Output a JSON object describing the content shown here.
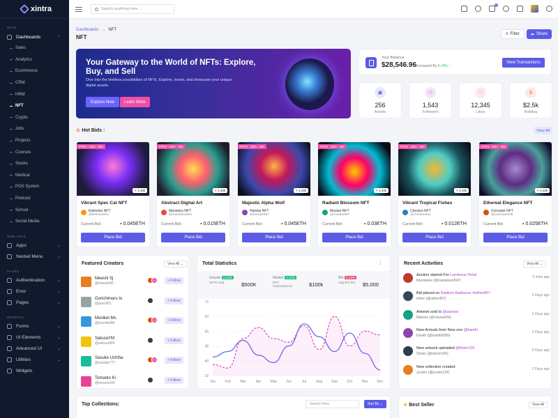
{
  "brand": {
    "name": "xintra"
  },
  "sidebar": {
    "section_main": "MAIN",
    "dashboards": "Dashboards",
    "dashboard_items": [
      "Sales",
      "Analytics",
      "Ecommerce",
      "CRM",
      "HRM",
      "NFT",
      "Crypto",
      "Jobs",
      "Projects",
      "Courses",
      "Stocks",
      "Medical",
      "POS System",
      "Podcast",
      "School",
      "Social Media"
    ],
    "active_item": "NFT",
    "section_web_apps": "WEB APPS",
    "apps": "Apps",
    "nested_menu": "Nested Menu",
    "section_pages": "PAGES",
    "authentication": "Authentication",
    "error": "Error",
    "pages": "Pages",
    "section_general": "GENERAL",
    "forms": "Forms",
    "ui_elements": "UI Elements",
    "advanced_ui": "Advanced UI",
    "utilities": "Utilities",
    "widgets": "Widgets"
  },
  "header": {
    "search_placeholder": "Search anything here ...",
    "cart_badge": "5"
  },
  "page": {
    "breadcrumb_root": "Dashboards",
    "breadcrumb_sep": "→",
    "breadcrumb_current": "NFT",
    "title": "NFT",
    "filter_label": "Filter",
    "share_label": "Share"
  },
  "hero": {
    "title": "Your Gateway to the World of NFTs: Explore, Buy, and Sell",
    "text": "Dive into the limitless possibilities of NFTs. Explore, invest, and showcase your unique digital assets.",
    "explore_label": "Explore Now",
    "learn_label": "Learn More"
  },
  "balance": {
    "label": "Your Balance",
    "value": "$28,546.96",
    "increase_label": "Increased By",
    "increase_value": "0.14%",
    "button": "View Transactions"
  },
  "stats": [
    {
      "value": "256",
      "label": "Assets",
      "color": "#5b5ce6"
    },
    {
      "value": "1,543",
      "label": "Followers",
      "color": "#ae3ec9"
    },
    {
      "value": "12,345",
      "label": "Likes",
      "color": "#ef4f8a"
    },
    {
      "value": "$2.5k",
      "label": "Bidding",
      "color": "#f06548"
    }
  ],
  "hot_bids": {
    "title": "Hot Bids :",
    "view_all": "View All",
    "cards": [
      {
        "timer": "07hrs : 33m : 45s",
        "likes": "1.43k",
        "name": "Vibrant Spec Cat NFT",
        "creator": "Kelinnies NFT",
        "handle": "@kelinnies04",
        "bid_label": "Current Bid :",
        "bid": "0.045ETH",
        "button": "Place Bid"
      },
      {
        "timer": "07hrs : 33m : 45s",
        "likes": "1.43k",
        "name": "Abstract Digital Art",
        "creator": "Manistics NFT",
        "handle": "@manistics454",
        "bid_label": "Current Bid :",
        "bid": "0.015ETH",
        "button": "Place Bid"
      },
      {
        "timer": "07hrs : 33m : 45s",
        "likes": "1.43k",
        "name": "Majestic Alpha Wolf",
        "creator": "Haridar NFT",
        "handle": "@haridar587",
        "bid_label": "Current Bid :",
        "bid": "0.045ETH",
        "button": "Place Bid"
      },
      {
        "timer": "07hrs : 33m : 45s",
        "likes": "1.43k",
        "name": "Radiant Blossom NFT",
        "creator": "Mostee NFT",
        "handle": "@mostee657",
        "bid_label": "Current Bid :",
        "bid": "0.03ETH",
        "button": "Place Bid"
      },
      {
        "timer": "07hrs : 33m : 45s",
        "likes": "1.43k",
        "name": "Vibrant Tropical Fishes",
        "creator": "Cheston NFT",
        "handle": "@cheston041",
        "bid_label": "Current Bid :",
        "bid": "0.012ETH",
        "button": "Place Bid"
      },
      {
        "timer": "07hrs : 33m : 45s",
        "likes": "1.43k",
        "name": "Ethereal Elegance NFT",
        "creator": "Cornoate NFT",
        "handle": "@cornoate245",
        "bid_label": "Current Bid :",
        "bid": "0.025ETH",
        "button": "Place Bid"
      }
    ]
  },
  "creators": {
    "title": "Featured Creators",
    "select": "View All",
    "follow_label": "+ Follow",
    "items": [
      {
        "name": "Meeshi Sj",
        "handle": "@meeshi05",
        "more": "+3"
      },
      {
        "name": "Gorichimaru Io",
        "handle": "@aaro901",
        "more": ""
      },
      {
        "name": "Moniket Ms",
        "handle": "@moniket98",
        "more": "+3"
      },
      {
        "name": "SakuraYM",
        "handle": "@sakura903",
        "more": ""
      },
      {
        "name": "Sasuke Uchiha",
        "handle": "@sasuke777",
        "more": "+3"
      },
      {
        "name": "Tomarko Ki",
        "handle": "@tomarko99",
        "more": ""
      }
    ]
  },
  "total_stats": {
    "title": "Total Statistics",
    "growth": {
      "label": "Growth",
      "badge": "0.14%",
      "sub": "NFTs sold",
      "value": "$500K"
    },
    "market": {
      "label": "Market",
      "badge": "0.14%",
      "sub": "NFT marketplaces",
      "value": "$100k"
    },
    "bid": {
      "label": "Bid",
      "badge": "0.14%",
      "sub": "Highest bid",
      "value": "$5,000"
    }
  },
  "chart_data": {
    "type": "line",
    "categories": [
      "Jan",
      "Feb",
      "Mar",
      "Apr",
      "May",
      "Jun",
      "Jul",
      "Aug",
      "Sep",
      "Oct",
      "Nov",
      "Dec"
    ],
    "yticks": [
      32,
      40,
      48,
      56,
      64,
      72
    ],
    "ylim": [
      32,
      72
    ],
    "series": [
      {
        "values": [
          42,
          45,
          51,
          43,
          39,
          48,
          60,
          53,
          45,
          55,
          44,
          35
        ],
        "color": "#5b5ce6"
      },
      {
        "values": [
          38,
          36,
          52,
          58,
          52,
          50,
          59,
          46,
          64,
          48,
          56,
          54
        ],
        "color": "#e040c8"
      }
    ]
  },
  "activities": {
    "title": "Recent Activities",
    "select": "View All",
    "items": [
      {
        "pre": "Auction started For ",
        "link": "Luminous Petal",
        "sub_pre": "Manistens ",
        "sub_link": "(@manistens547)",
        "time": "5 mins ago"
      },
      {
        "pre": "Bid placed on ",
        "link": "Radium Radiance #isther457",
        "sub_pre": "isther ",
        "sub_link": "(@isther457)",
        "time": "2 Days ago"
      },
      {
        "pre": "Artwork sold to ",
        "link": "@zanisis",
        "sub_pre": "Rakons ",
        "sub_link": "(@rokons656)",
        "time": "2 Days ago"
      },
      {
        "pre": "New Arrivals from New one ",
        "link": "@kanith",
        "sub_pre": "Kanith ",
        "sub_link": "(@kanith6589)",
        "time": "2 Days ago"
      },
      {
        "pre": "New artwork uploaded ",
        "link": "@fister124",
        "sub_pre": "Simon ",
        "sub_link": "(@simon145)",
        "time": "5 Days ago"
      },
      {
        "pre": "New collection created.",
        "link": "",
        "sub_pre": "Jovisin ",
        "sub_link": "(@jovisin124)",
        "time": "2 Days ago"
      }
    ]
  },
  "collections": {
    "title": "Top Collections:",
    "search_placeholder": "Search Here",
    "sort_label": "Sort By"
  },
  "best_seller": {
    "title": "Best Seller",
    "view_all": "View All"
  }
}
